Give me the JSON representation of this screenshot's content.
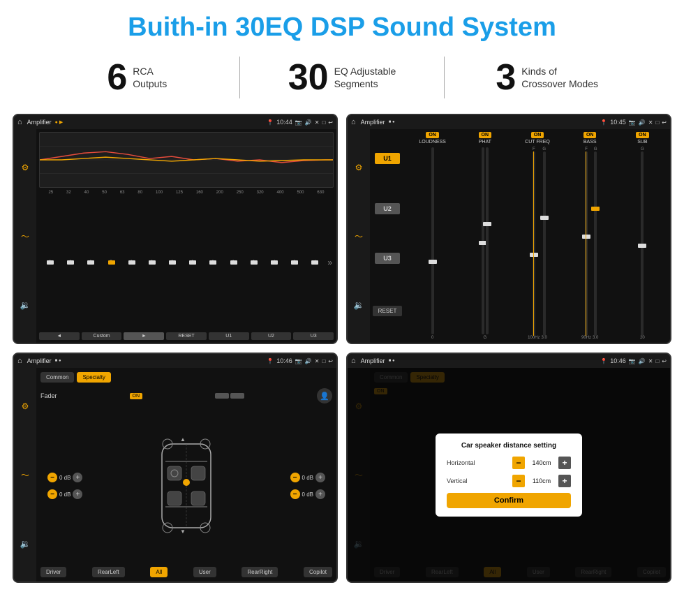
{
  "page": {
    "title": "Buith-in 30EQ DSP Sound System",
    "stats": [
      {
        "number": "6",
        "label": "RCA\nOutputs"
      },
      {
        "number": "30",
        "label": "EQ Adjustable\nSegments"
      },
      {
        "number": "3",
        "label": "Kinds of\nCrossover Modes"
      }
    ]
  },
  "screens": {
    "eq": {
      "title": "Amplifier",
      "time": "10:44",
      "freqs": [
        "25",
        "32",
        "40",
        "50",
        "63",
        "80",
        "100",
        "125",
        "160",
        "200",
        "250",
        "320",
        "400",
        "500",
        "630"
      ],
      "values": [
        "0",
        "0",
        "0",
        "5",
        "0",
        "0",
        "0",
        "0",
        "0",
        "0",
        "0",
        "-1",
        "0",
        "-1"
      ],
      "buttons": [
        "◄",
        "Custom",
        "►",
        "RESET",
        "U1",
        "U2",
        "U3"
      ]
    },
    "crossover": {
      "title": "Amplifier",
      "time": "10:45",
      "channels": [
        "LOUDNESS",
        "PHAT",
        "CUT FREQ",
        "BASS",
        "SUB"
      ],
      "units": [
        "U1",
        "U2",
        "U3"
      ],
      "reset": "RESET"
    },
    "fader": {
      "title": "Amplifier",
      "time": "10:46",
      "tabs": [
        "Common",
        "Specialty"
      ],
      "fader_label": "Fader",
      "on_label": "ON",
      "db_values": [
        "0 dB",
        "0 dB",
        "0 dB",
        "0 dB"
      ],
      "bottom_buttons": [
        "Driver",
        "RearLeft",
        "All",
        "User",
        "RearRight",
        "Copilot"
      ]
    },
    "dialog": {
      "title": "Amplifier",
      "time": "10:46",
      "tabs": [
        "Common",
        "Specialty"
      ],
      "dialog_title": "Car speaker distance setting",
      "horizontal_label": "Horizontal",
      "horizontal_value": "140cm",
      "vertical_label": "Vertical",
      "vertical_value": "110cm",
      "confirm_label": "Confirm",
      "on_label": "ON",
      "bottom_buttons": [
        "Driver",
        "RearLeft",
        "All",
        "User",
        "RearRight",
        "Copilot"
      ]
    }
  },
  "icons": {
    "home": "⌂",
    "back": "↩",
    "location": "📍",
    "volume": "🔊",
    "equalizer": "≡",
    "waveform": "〜",
    "speaker": "🔉",
    "person": "👤",
    "close": "✕",
    "minimize": "─",
    "maximize": "□"
  }
}
